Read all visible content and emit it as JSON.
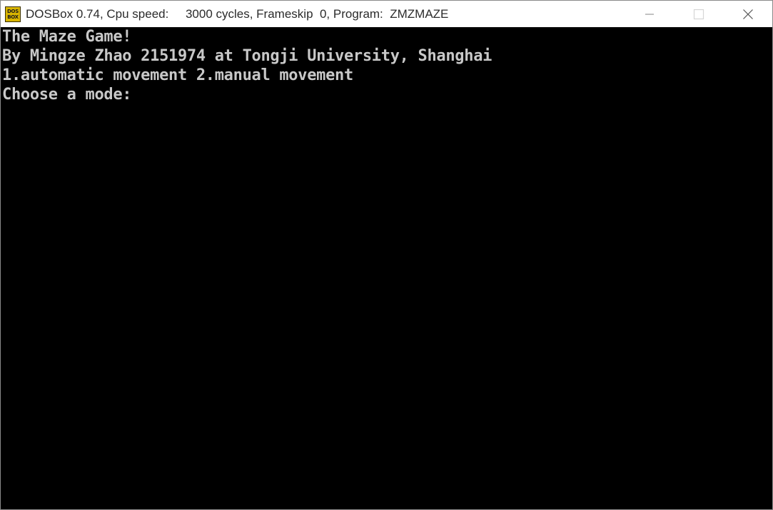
{
  "window": {
    "icon_text_top": "DOS",
    "icon_text_bottom": "BOX",
    "title": "DOSBox 0.74, Cpu speed:     3000 cycles, Frameskip  0, Program:  ZMZMAZE"
  },
  "screen": {
    "lines": [
      "The Maze Game!",
      "By Mingze Zhao 2151974 at Tongji University, Shanghai",
      "1.automatic movement 2.manual movement",
      "Choose a mode:"
    ],
    "text_color": "#c8c8c8",
    "background": "#000000"
  }
}
